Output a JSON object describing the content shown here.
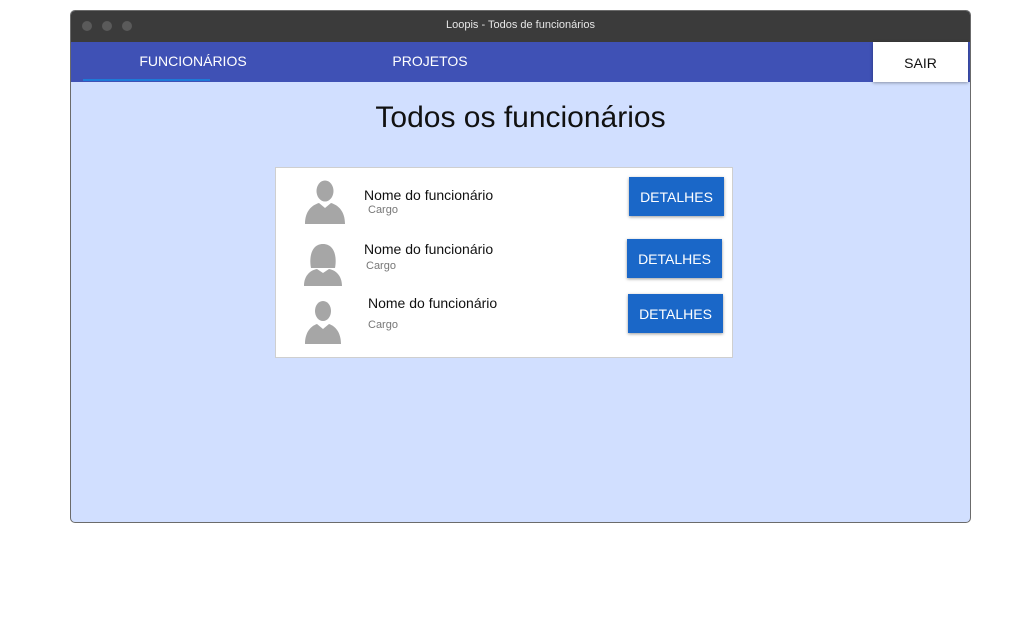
{
  "window": {
    "title": "Loopis - Todos de funcionários"
  },
  "nav": {
    "tabs": [
      {
        "label": "FUNCIONÁRIOS",
        "active": true
      },
      {
        "label": "PROJETOS",
        "active": false
      }
    ],
    "logout_label": "SAIR"
  },
  "main": {
    "title": "Todos os funcionários",
    "employees": [
      {
        "name": "Nome do funcionário",
        "role": "Cargo",
        "avatar": "male-avatar-icon",
        "button": "DETALHES"
      },
      {
        "name": "Nome do funcionário",
        "role": "Cargo",
        "avatar": "female-avatar-icon",
        "button": "DETALHES"
      },
      {
        "name": "Nome do funcionário",
        "role": "Cargo",
        "avatar": "male-avatar-icon",
        "button": "DETALHES"
      }
    ]
  },
  "colors": {
    "navbar": "#3f51b5",
    "background": "#d1dfff",
    "button": "#1a67c8",
    "titlebar": "#3b3b3b"
  }
}
